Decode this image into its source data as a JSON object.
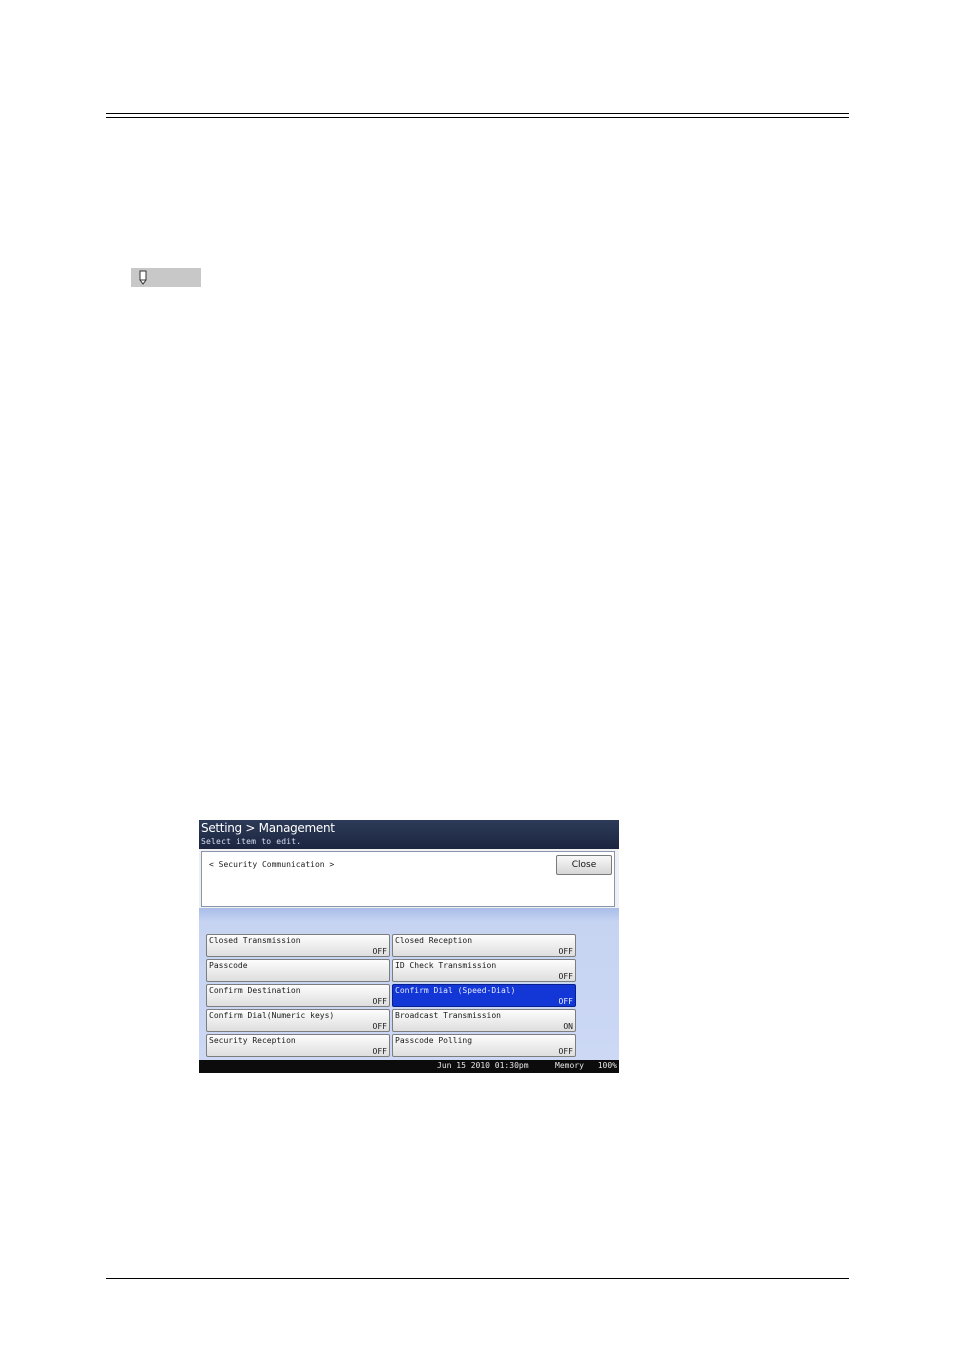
{
  "screen": {
    "title": "Setting > Management",
    "subtitle": "Select item to edit.",
    "section": "< Security Communication  >",
    "close_label": "Close",
    "items": [
      {
        "label": "Closed Transmission",
        "value": "OFF"
      },
      {
        "label": "Closed Reception",
        "value": "OFF"
      },
      {
        "label": "Passcode",
        "value": ""
      },
      {
        "label": "ID Check Transmission",
        "value": "OFF"
      },
      {
        "label": "Confirm Destination",
        "value": "OFF"
      },
      {
        "label": "Confirm Dial (Speed-Dial)",
        "value": "OFF"
      },
      {
        "label": "Confirm Dial(Numeric keys)",
        "value": "OFF"
      },
      {
        "label": "Broadcast Transmission",
        "value": "ON"
      },
      {
        "label": "Security Reception",
        "value": "OFF"
      },
      {
        "label": "Passcode Polling",
        "value": "OFF"
      }
    ],
    "selected_item": "Confirm Dial (Speed-Dial)",
    "status": {
      "datetime": "Jun 15 2010 01:30pm",
      "memory_label": "Memory",
      "memory_value": "100%"
    }
  },
  "icons": {
    "note": "note-pencil-icon"
  },
  "colors": {
    "title_bar": "#1b2540",
    "selected": "#1336d6",
    "blue_area": "#ccd8f4",
    "status_bar": "#0c0c0c"
  }
}
